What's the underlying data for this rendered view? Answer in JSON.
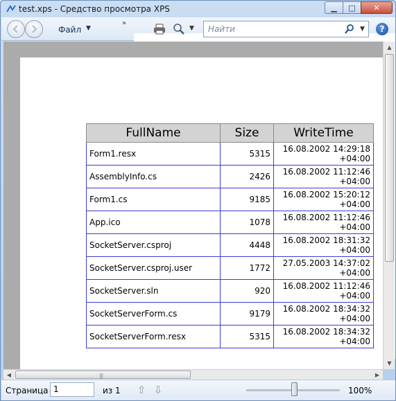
{
  "window": {
    "title": "test.xps - Средство просмотра XPS",
    "min_label": "▁",
    "max_label": "□",
    "close_label": "✕"
  },
  "toolbar": {
    "file_menu": "Файл",
    "menu_arrow": "▼",
    "overflow": "»",
    "search_placeholder": "Найти",
    "help_label": "?"
  },
  "table": {
    "headers": [
      "FullName",
      "Size",
      "WriteTime"
    ],
    "rows": [
      {
        "name": "Form1.resx",
        "size": "5315",
        "time1": "16.08.2002 14:29:18",
        "time2": "+04:00"
      },
      {
        "name": "AssemblyInfo.cs",
        "size": "2426",
        "time1": "16.08.2002 11:12:46",
        "time2": "+04:00"
      },
      {
        "name": "Form1.cs",
        "size": "9185",
        "time1": "16.08.2002 15:20:12",
        "time2": "+04:00"
      },
      {
        "name": "App.ico",
        "size": "1078",
        "time1": "16.08.2002 11:12:46",
        "time2": "+04:00"
      },
      {
        "name": "SocketServer.csproj",
        "size": "4448",
        "time1": "16.08.2002 18:31:32",
        "time2": "+04:00"
      },
      {
        "name": "SocketServer.csproj.user",
        "size": "1772",
        "time1": "27.05.2003 14:37:02",
        "time2": "+04:00"
      },
      {
        "name": "SocketServer.sln",
        "size": "920",
        "time1": "16.08.2002 11:12:46",
        "time2": "+04:00"
      },
      {
        "name": "SocketServerForm.cs",
        "size": "9179",
        "time1": "16.08.2002 18:34:32",
        "time2": "+04:00"
      },
      {
        "name": "SocketServerForm.resx",
        "size": "5315",
        "time1": "16.08.2002 18:34:32",
        "time2": "+04:00"
      }
    ]
  },
  "status": {
    "page_label": "Страница",
    "page_value": "1",
    "of_label": "из 1",
    "zoom": "100%"
  },
  "icons": {
    "back": "back-arrow-icon",
    "forward": "forward-arrow-icon",
    "page": "page-view-icon",
    "print": "printer-icon",
    "zoom": "magnifier-icon",
    "search": "search-icon",
    "help": "help-icon"
  },
  "colors": {
    "table_border": "#3b3bd6",
    "header_bg": "#d3d3d3",
    "viewport_bg": "#ababab"
  }
}
